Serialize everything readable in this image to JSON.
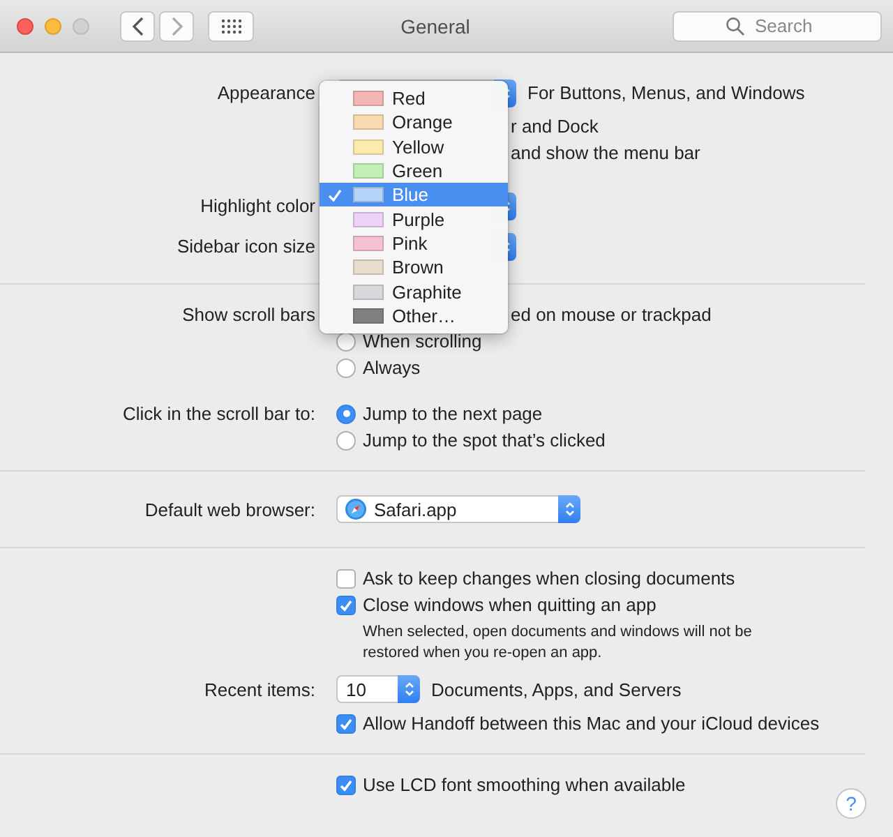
{
  "window": {
    "title": "General",
    "search": {
      "placeholder": "Search"
    }
  },
  "sections": [
    {
      "rows": [
        {
          "kind": "popup",
          "label": "Appearance",
          "note": "For Buttons, Menus, and Windows"
        },
        {
          "kind": "fragment",
          "text": "r and Dock"
        },
        {
          "kind": "fragment",
          "text": "and show the menu bar"
        },
        {
          "kind": "gap"
        },
        {
          "kind": "popup",
          "label": "Highlight color"
        },
        {
          "kind": "popup",
          "label": "Sidebar icon size"
        }
      ]
    },
    {
      "rows": [
        {
          "kind": "fragment",
          "label": "Show scroll bars",
          "text": "ed on mouse or trackpad"
        },
        {
          "kind": "radio",
          "text": "When scrolling",
          "selected": false
        },
        {
          "kind": "radio",
          "text": "Always",
          "selected": false
        },
        {
          "kind": "gap"
        },
        {
          "kind": "radio",
          "label": "Click in the scroll bar to:",
          "text": "Jump to the next page",
          "selected": true
        },
        {
          "kind": "radio",
          "text": "Jump to the spot that’s clicked",
          "selected": false
        }
      ]
    },
    {
      "rows": [
        {
          "kind": "browser",
          "label": "Default web browser:",
          "value": "Safari.app"
        }
      ]
    },
    {
      "rows": [
        {
          "kind": "checkbox",
          "text": "Ask to keep changes when closing documents",
          "checked": false
        },
        {
          "kind": "checkbox",
          "text": "Close windows when quitting an app",
          "checked": true
        },
        {
          "kind": "note",
          "text": "When selected, open documents and windows will not be restored when you re-open an app."
        },
        {
          "kind": "stepper",
          "label": "Recent items:",
          "value": "10",
          "note": "Documents, Apps, and Servers"
        },
        {
          "kind": "checkbox",
          "text": "Allow Handoff between this Mac and your iCloud devices",
          "checked": true
        }
      ]
    },
    {
      "rows": [
        {
          "kind": "checkbox",
          "text": "Use LCD font smoothing when available",
          "checked": true
        }
      ]
    }
  ],
  "help": "?",
  "menu": [
    {
      "label": "Red",
      "color": "#f4b6b4",
      "selected": false
    },
    {
      "label": "Orange",
      "color": "#f8dab0",
      "selected": false
    },
    {
      "label": "Yellow",
      "color": "#fbecad",
      "selected": false
    },
    {
      "label": "Green",
      "color": "#c4f0b4",
      "selected": false
    },
    {
      "label": "Blue",
      "color": "#b4d4f8",
      "selected": true
    },
    {
      "label": "Purple",
      "color": "#ecd2f8",
      "selected": false
    },
    {
      "label": "Pink",
      "color": "#f4c2d0",
      "selected": false
    },
    {
      "label": "Brown",
      "color": "#e8dccc",
      "selected": false
    },
    {
      "label": "Graphite",
      "color": "#d8d8dc",
      "selected": false
    },
    {
      "label": "Other…",
      "color": "#808080",
      "selected": false
    }
  ]
}
